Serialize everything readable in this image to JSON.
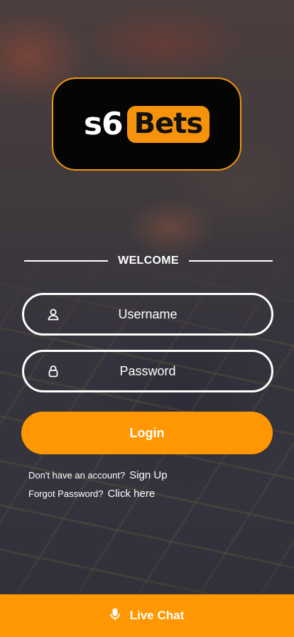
{
  "brand": {
    "logo_left": "s6",
    "logo_right": "Bets",
    "accent": "#ff9702"
  },
  "welcome": {
    "title": "WELCOME"
  },
  "form": {
    "username": {
      "placeholder": "Username",
      "value": "",
      "icon": "user-icon"
    },
    "password": {
      "placeholder": "Password",
      "value": "",
      "icon": "lock-icon"
    },
    "login_label": "Login"
  },
  "links": {
    "signup_prompt": "Don't have an account?",
    "signup_label": "Sign Up",
    "forgot_prompt": "Forgot Password?",
    "forgot_label": "Click here"
  },
  "footer": {
    "live_chat_label": "Live Chat",
    "icon": "microphone-icon"
  }
}
